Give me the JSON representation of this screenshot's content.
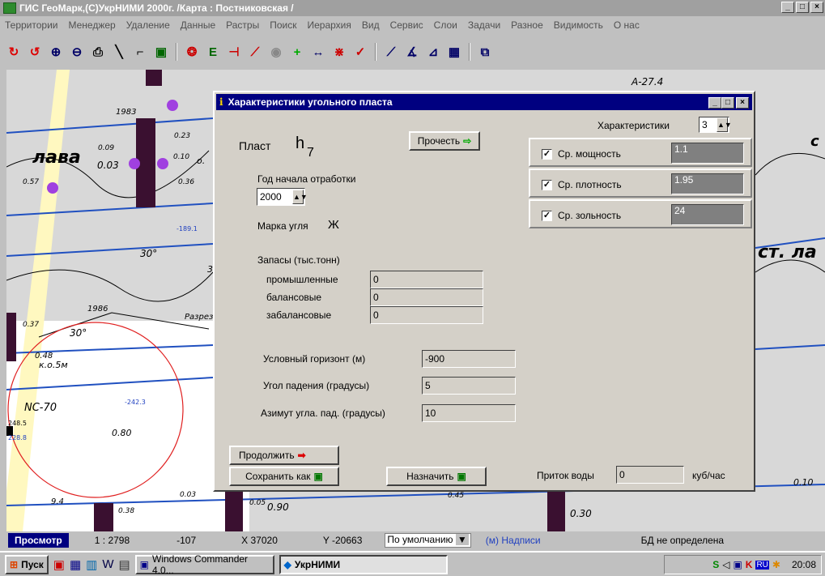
{
  "window": {
    "title": "ГИС ГеоМарк,(С)УкрНИМИ 2000г.  /Карта : Постниковская /"
  },
  "menu": [
    "Территории",
    "Менеджер",
    "Удаление",
    "Данные",
    "Растры",
    "Поиск",
    "Иерархия",
    "Вид",
    "Сервис",
    "Слои",
    "Задачи",
    "Разное",
    "Видимость",
    "О нас"
  ],
  "map": {
    "labels": {
      "lava": "лава",
      "st_la": "ст. ла",
      "a274": "A-27.4",
      "y1983": "1983",
      "y1986": "1986",
      "nc70": "NC-70",
      "k05": "к.о.5м",
      "razrez": "Разрез",
      "d30a": "30°",
      "d30b": "30°",
      "v009": "0.09",
      "v003": "0.03",
      "v023": "0.23",
      "v010": "0.10",
      "v036": "0.36",
      "v057": "0.57",
      "v037": "0.37",
      "v048": "0.48",
      "v080": "0.80",
      "v94": "9.4",
      "v038": "0.38",
      "v090": "0.90",
      "v003b": "0.03",
      "v030": "0.30",
      "v010b": "0.10",
      "v248": "248.5",
      "v2288": "228.8",
      "v2423": "-242.3",
      "v1891": "-189.1",
      "v005": "0.05",
      "v045": "0.45",
      "c": "с",
      "o": "о.",
      "a3": "3"
    }
  },
  "dialog": {
    "title": "Характеристики угольного пласта",
    "plast_label": "Пласт",
    "plast_name": "h",
    "plast_sub": "7",
    "read_button": "Прочесть",
    "year_label": "Год начала отработки",
    "year_value": "2000",
    "coal_grade_label": "Марка угля",
    "coal_grade_value": "Ж",
    "reserves_label": "Запасы  (тыс.тонн)",
    "reserves": [
      {
        "label": "промышленные",
        "value": "0"
      },
      {
        "label": "балансовые",
        "value": "0"
      },
      {
        "label": "забалансовые",
        "value": "0"
      }
    ],
    "horizon_label": "Условный горизонт (м)",
    "horizon_value": "-900",
    "dip_angle_label": "Угол падения (градусы)",
    "dip_angle_value": "5",
    "azimuth_label": "Азимут угла. пад. (градусы)",
    "azimuth_value": "10",
    "characteristics_label": "Характеристики",
    "characteristics_count": "3",
    "characteristics": [
      {
        "label": "Ср. мощность",
        "value": "1.1",
        "checked": true
      },
      {
        "label": "Ср. плотность",
        "value": "1.95",
        "checked": true
      },
      {
        "label": "Ср. зольность",
        "value": "24",
        "checked": true
      }
    ],
    "continue_button": "Продолжить",
    "save_as_button": "Сохранить как",
    "assign_button": "Назначить",
    "water_inflow_label": "Приток воды",
    "water_inflow_value": "0",
    "water_inflow_unit": "куб/час"
  },
  "status": {
    "mode": "Просмотр",
    "scale": "1 : 2798",
    "value": "-107",
    "x": "X 37020",
    "y": "Y -20663",
    "default_select": "По умолчанию",
    "labels": "(м) Надписи",
    "db": "БД не определена"
  },
  "taskbar": {
    "start": "Пуск",
    "tasks": [
      "Windows Commander 4.0...",
      "УкрНИМИ"
    ],
    "lang": "RU",
    "clock": "20:08"
  },
  "colors": {
    "title_active": "#000080",
    "title_inactive": "#a0a0a0",
    "face": "#d4d0c8"
  }
}
